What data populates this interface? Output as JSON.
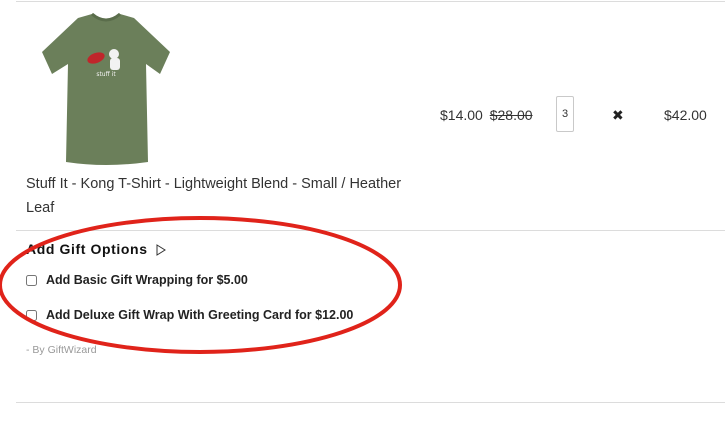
{
  "cart_item": {
    "product_name": "Stuff It - Kong T-Shirt - Lightweight Blend - Small / Heather Leaf",
    "shirt_print": "stuff it",
    "sale_price": "$14.00",
    "original_price": "$28.00",
    "quantity": "3",
    "remove_icon": "✖",
    "line_total": "$42.00",
    "shirt_color": "#6b7f5a"
  },
  "gift_options": {
    "title": "Add Gift Options",
    "toggle_icon": "▷",
    "options": [
      {
        "label": "Add Basic Gift Wrapping for $5.00",
        "checked": false
      },
      {
        "label": "Add Deluxe Gift Wrap With Greeting Card for $12.00",
        "checked": false
      }
    ],
    "attribution": "- By GiftWizard"
  },
  "annotation_color": "#e0231a"
}
